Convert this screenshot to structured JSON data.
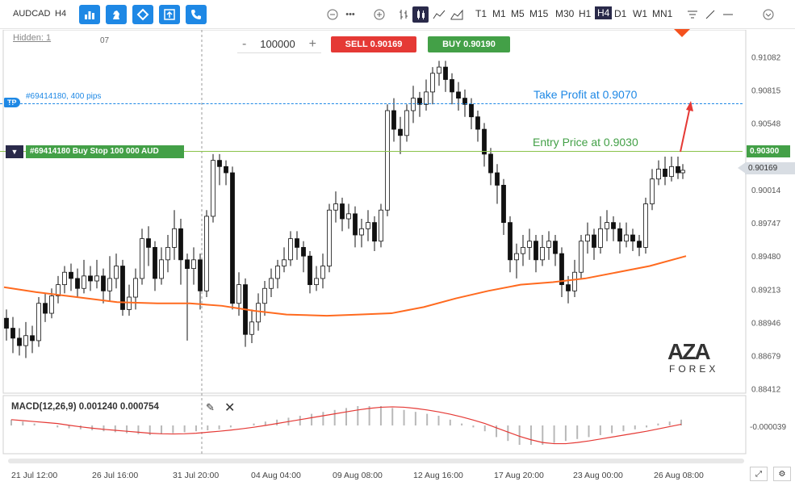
{
  "toolbar": {
    "symbol": "AUDCAD",
    "timeframe_short": "H4",
    "timeframes": [
      "T1",
      "M1",
      "M5",
      "M15",
      "M30",
      "H1",
      "H4",
      "D1",
      "W1",
      "MN1"
    ],
    "active_timeframe": "H4",
    "buttons": [
      "bar-chart-icon",
      "chess-knight-icon",
      "diamond-icon",
      "upload-box-icon",
      "phone-icon"
    ],
    "accent_color": "#1e88e5"
  },
  "chart": {
    "hidden_label": "Hidden: 1",
    "top_tick": "07",
    "lots_value": "100000",
    "minus": "-",
    "plus": "+",
    "sell_label": "SELL 0.90169",
    "buy_label": "BUY 0.90190",
    "tp_badge": "TP",
    "tp_order_text": "#69414180, 400 pips",
    "take_profit_text": "Take Profit at 0.9070",
    "entry_text": "Entry Price at 0.9030",
    "order_label": "#69414180 Buy Stop 100 000 AUD",
    "entry_price_tag": "0.90300",
    "current_price_tag": "0.90169",
    "macd_label": "MACD(12,26,9) 0.001240 0.000754",
    "macd_tick": "-0.000039",
    "logo_main": "AZA",
    "logo_sub": "FOREX",
    "price_axis": [
      "0.91082",
      "0.90815",
      "0.90548",
      "0.90300",
      "0.90169",
      "0.90014",
      "0.89747",
      "0.89480",
      "0.89213",
      "0.88946",
      "0.88679",
      "0.88412"
    ],
    "time_axis": [
      "21 Jul 12:00",
      "26 Jul 16:00",
      "31 Jul 20:00",
      "04 Aug 04:00",
      "09 Aug 08:00",
      "12 Aug 16:00",
      "17 Aug 20:00",
      "23 Aug 00:00",
      "26 Aug 08:00"
    ]
  },
  "chart_data": {
    "type": "line",
    "ma": [
      [
        0,
        0.8923
      ],
      [
        40,
        0.8919
      ],
      [
        90,
        0.8915
      ],
      [
        140,
        0.8911
      ],
      [
        190,
        0.891
      ],
      [
        230,
        0.891
      ],
      [
        270,
        0.8908
      ],
      [
        310,
        0.8904
      ],
      [
        350,
        0.8901
      ],
      [
        400,
        0.89
      ],
      [
        440,
        0.8901
      ],
      [
        480,
        0.8902
      ],
      [
        520,
        0.8907
      ],
      [
        560,
        0.8914
      ],
      [
        600,
        0.892
      ],
      [
        640,
        0.8925
      ],
      [
        680,
        0.8927
      ],
      [
        720,
        0.893
      ],
      [
        760,
        0.8935
      ],
      [
        800,
        0.894
      ],
      [
        845,
        0.8948
      ]
    ],
    "candles": [
      [
        8,
        0.8898,
        0.889,
        0.8905,
        0.888
      ],
      [
        16,
        0.889,
        0.8882,
        0.8899,
        0.887
      ],
      [
        24,
        0.8882,
        0.8876,
        0.889,
        0.8868
      ],
      [
        32,
        0.8876,
        0.8884,
        0.8895,
        0.8866
      ],
      [
        40,
        0.8884,
        0.888,
        0.8892,
        0.887
      ],
      [
        48,
        0.888,
        0.891,
        0.8915,
        0.8875
      ],
      [
        56,
        0.891,
        0.8902,
        0.8918,
        0.8895
      ],
      [
        64,
        0.8902,
        0.8916,
        0.8922,
        0.8898
      ],
      [
        72,
        0.8916,
        0.8925,
        0.8932,
        0.891
      ],
      [
        80,
        0.8925,
        0.8935,
        0.894,
        0.8918
      ],
      [
        88,
        0.8935,
        0.893,
        0.8942,
        0.892
      ],
      [
        96,
        0.893,
        0.8922,
        0.8938,
        0.8915
      ],
      [
        104,
        0.8922,
        0.8932,
        0.8945,
        0.8918
      ],
      [
        112,
        0.8932,
        0.8928,
        0.894,
        0.892
      ],
      [
        120,
        0.8928,
        0.8932,
        0.8945,
        0.8922
      ],
      [
        128,
        0.8932,
        0.892,
        0.8938,
        0.891
      ],
      [
        136,
        0.892,
        0.893,
        0.8948,
        0.8912
      ],
      [
        144,
        0.893,
        0.894,
        0.895,
        0.8922
      ],
      [
        152,
        0.894,
        0.8905,
        0.8945,
        0.89
      ],
      [
        160,
        0.8905,
        0.8915,
        0.8925,
        0.89
      ],
      [
        168,
        0.8915,
        0.893,
        0.8938,
        0.8905
      ],
      [
        176,
        0.893,
        0.8962,
        0.897,
        0.8925
      ],
      [
        184,
        0.8962,
        0.8955,
        0.8972,
        0.894
      ],
      [
        192,
        0.8955,
        0.893,
        0.896,
        0.892
      ],
      [
        200,
        0.893,
        0.8945,
        0.8955,
        0.8925
      ],
      [
        208,
        0.8945,
        0.8955,
        0.8965,
        0.8935
      ],
      [
        216,
        0.8955,
        0.897,
        0.8985,
        0.8945
      ],
      [
        224,
        0.897,
        0.8945,
        0.8978,
        0.8925
      ],
      [
        232,
        0.8945,
        0.8938,
        0.895,
        0.888
      ],
      [
        240,
        0.8938,
        0.8945,
        0.8955,
        0.8925
      ],
      [
        248,
        0.8945,
        0.892,
        0.895,
        0.8905
      ],
      [
        256,
        0.892,
        0.898,
        0.8985,
        0.8915
      ],
      [
        264,
        0.898,
        0.9025,
        0.903,
        0.8975
      ],
      [
        272,
        0.9025,
        0.902,
        0.903,
        0.9005
      ],
      [
        280,
        0.902,
        0.9015,
        0.9025,
        0.9005
      ],
      [
        288,
        0.9015,
        0.891,
        0.902,
        0.8905
      ],
      [
        296,
        0.891,
        0.8925,
        0.8935,
        0.89
      ],
      [
        304,
        0.8925,
        0.8885,
        0.893,
        0.8875
      ],
      [
        312,
        0.8885,
        0.8895,
        0.8905,
        0.8878
      ],
      [
        320,
        0.8895,
        0.891,
        0.8918,
        0.8888
      ],
      [
        328,
        0.891,
        0.8922,
        0.8928,
        0.89
      ],
      [
        336,
        0.8922,
        0.893,
        0.8938,
        0.8915
      ],
      [
        344,
        0.893,
        0.894,
        0.8945,
        0.8922
      ],
      [
        352,
        0.894,
        0.8945,
        0.8955,
        0.8935
      ],
      [
        360,
        0.8945,
        0.8962,
        0.8968,
        0.894
      ],
      [
        368,
        0.8962,
        0.8955,
        0.8968,
        0.8945
      ],
      [
        376,
        0.8955,
        0.8948,
        0.896,
        0.8935
      ],
      [
        384,
        0.8948,
        0.8925,
        0.8952,
        0.8918
      ],
      [
        392,
        0.8925,
        0.893,
        0.894,
        0.892
      ],
      [
        400,
        0.893,
        0.894,
        0.895,
        0.8922
      ],
      [
        408,
        0.894,
        0.8985,
        0.899,
        0.8935
      ],
      [
        416,
        0.8985,
        0.899,
        0.9,
        0.8975
      ],
      [
        424,
        0.899,
        0.8978,
        0.8995,
        0.8968
      ],
      [
        432,
        0.8978,
        0.8982,
        0.899,
        0.897
      ],
      [
        440,
        0.8982,
        0.8965,
        0.8988,
        0.8955
      ],
      [
        448,
        0.8965,
        0.897,
        0.8978,
        0.8955
      ],
      [
        456,
        0.897,
        0.8975,
        0.8985,
        0.896
      ],
      [
        464,
        0.8975,
        0.896,
        0.898,
        0.8952
      ],
      [
        472,
        0.896,
        0.8985,
        0.899,
        0.8955
      ],
      [
        480,
        0.8985,
        0.9065,
        0.907,
        0.898
      ],
      [
        488,
        0.9065,
        0.905,
        0.9075,
        0.904
      ],
      [
        496,
        0.905,
        0.9045,
        0.906,
        0.903
      ],
      [
        504,
        0.9045,
        0.9065,
        0.907,
        0.904
      ],
      [
        512,
        0.9065,
        0.9075,
        0.9085,
        0.9055
      ],
      [
        520,
        0.9075,
        0.907,
        0.908,
        0.906
      ],
      [
        528,
        0.907,
        0.908,
        0.909,
        0.9065
      ],
      [
        536,
        0.908,
        0.9095,
        0.91,
        0.907
      ],
      [
        544,
        0.9095,
        0.91,
        0.9105,
        0.9085
      ],
      [
        552,
        0.91,
        0.909,
        0.9105,
        0.908
      ],
      [
        560,
        0.909,
        0.908,
        0.9095,
        0.907
      ],
      [
        568,
        0.908,
        0.9075,
        0.9088,
        0.9065
      ],
      [
        576,
        0.9075,
        0.907,
        0.9082,
        0.906
      ],
      [
        584,
        0.907,
        0.906,
        0.9075,
        0.905
      ],
      [
        592,
        0.906,
        0.905,
        0.9065,
        0.904
      ],
      [
        600,
        0.905,
        0.903,
        0.9055,
        0.902
      ],
      [
        608,
        0.903,
        0.9015,
        0.9035,
        0.9005
      ],
      [
        616,
        0.9015,
        0.9005,
        0.9022,
        0.899
      ],
      [
        624,
        0.9005,
        0.8975,
        0.901,
        0.8965
      ],
      [
        632,
        0.8975,
        0.8945,
        0.898,
        0.8935
      ],
      [
        640,
        0.8945,
        0.895,
        0.8958,
        0.893
      ],
      [
        648,
        0.895,
        0.8955,
        0.8965,
        0.894
      ],
      [
        656,
        0.8955,
        0.896,
        0.897,
        0.8945
      ],
      [
        664,
        0.896,
        0.8945,
        0.8965,
        0.8935
      ],
      [
        672,
        0.8945,
        0.8955,
        0.8965,
        0.894
      ],
      [
        680,
        0.8955,
        0.896,
        0.8968,
        0.8945
      ],
      [
        688,
        0.896,
        0.895,
        0.8965,
        0.894
      ],
      [
        696,
        0.895,
        0.8925,
        0.8955,
        0.8915
      ],
      [
        704,
        0.8925,
        0.892,
        0.8932,
        0.891
      ],
      [
        712,
        0.892,
        0.8935,
        0.8945,
        0.8915
      ],
      [
        720,
        0.8935,
        0.896,
        0.8965,
        0.893
      ],
      [
        728,
        0.896,
        0.8965,
        0.8975,
        0.895
      ],
      [
        736,
        0.8965,
        0.8955,
        0.897,
        0.8945
      ],
      [
        744,
        0.8955,
        0.897,
        0.898,
        0.895
      ],
      [
        752,
        0.897,
        0.8975,
        0.8985,
        0.896
      ],
      [
        760,
        0.8975,
        0.897,
        0.898,
        0.896
      ],
      [
        768,
        0.897,
        0.896,
        0.8975,
        0.895
      ],
      [
        776,
        0.896,
        0.8965,
        0.8975,
        0.8955
      ],
      [
        784,
        0.8965,
        0.896,
        0.897,
        0.8952
      ],
      [
        792,
        0.896,
        0.8955,
        0.8965,
        0.8948
      ],
      [
        800,
        0.8955,
        0.899,
        0.8995,
        0.895
      ],
      [
        808,
        0.899,
        0.901,
        0.9018,
        0.8985
      ],
      [
        816,
        0.901,
        0.9018,
        0.9025,
        0.9005
      ],
      [
        824,
        0.9018,
        0.9012,
        0.9028,
        0.9005
      ],
      [
        832,
        0.9012,
        0.902,
        0.9028,
        0.9008
      ],
      [
        840,
        0.902,
        0.9015,
        0.9028,
        0.901
      ],
      [
        846,
        0.9015,
        0.9017,
        0.9022,
        0.901
      ]
    ],
    "macd_hist": [
      0.3,
      0.2,
      0.1,
      0,
      -0.1,
      -0.15,
      -0.2,
      -0.25,
      -0.3,
      -0.35,
      -0.4,
      -0.45,
      -0.5,
      -0.45,
      -0.4,
      -0.35,
      -0.3,
      -0.25,
      -0.2,
      -0.1,
      0,
      0.1,
      0.2,
      0.3,
      0.4,
      0.5,
      0.6,
      0.7,
      0.8,
      0.9,
      1,
      1,
      1,
      0.9,
      0.8,
      0.7,
      0.6,
      0.5,
      0.3,
      0.1,
      -0.1,
      -0.3,
      -0.6,
      -0.8,
      -1,
      -1,
      -1,
      -0.9,
      -0.8,
      -0.7,
      -0.6,
      -0.5,
      -0.4,
      -0.3,
      -0.2,
      -0.1,
      0.1,
      0.2,
      0.3
    ],
    "price_min": 0.8841,
    "price_max": 0.9115,
    "ylabel": "",
    "xlabel": ""
  }
}
